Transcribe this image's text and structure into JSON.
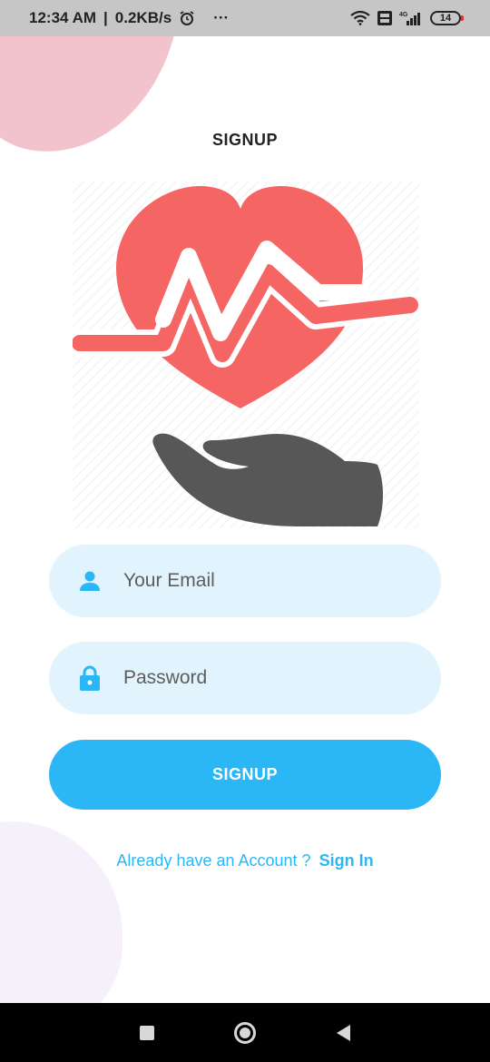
{
  "status_bar": {
    "time": "12:34 AM",
    "separator": "|",
    "speed": "0.2KB/s",
    "more": "···",
    "battery": "14"
  },
  "header": {
    "title": "SIGNUP"
  },
  "form": {
    "email_placeholder": "Your Email",
    "password_placeholder": "Password",
    "submit_label": "SIGNUP"
  },
  "footer": {
    "prompt": "Already have an Account ?",
    "link": "Sign In"
  },
  "colors": {
    "accent": "#2bb7f5",
    "input_bg": "#e1f4fd",
    "heart": "#f46563",
    "hand": "#575757"
  },
  "icons": [
    "alarm-icon",
    "wifi-icon",
    "volte-icon",
    "signal-icon",
    "battery-icon",
    "heart-pulse-icon",
    "hand-icon",
    "user-icon",
    "lock-icon"
  ]
}
